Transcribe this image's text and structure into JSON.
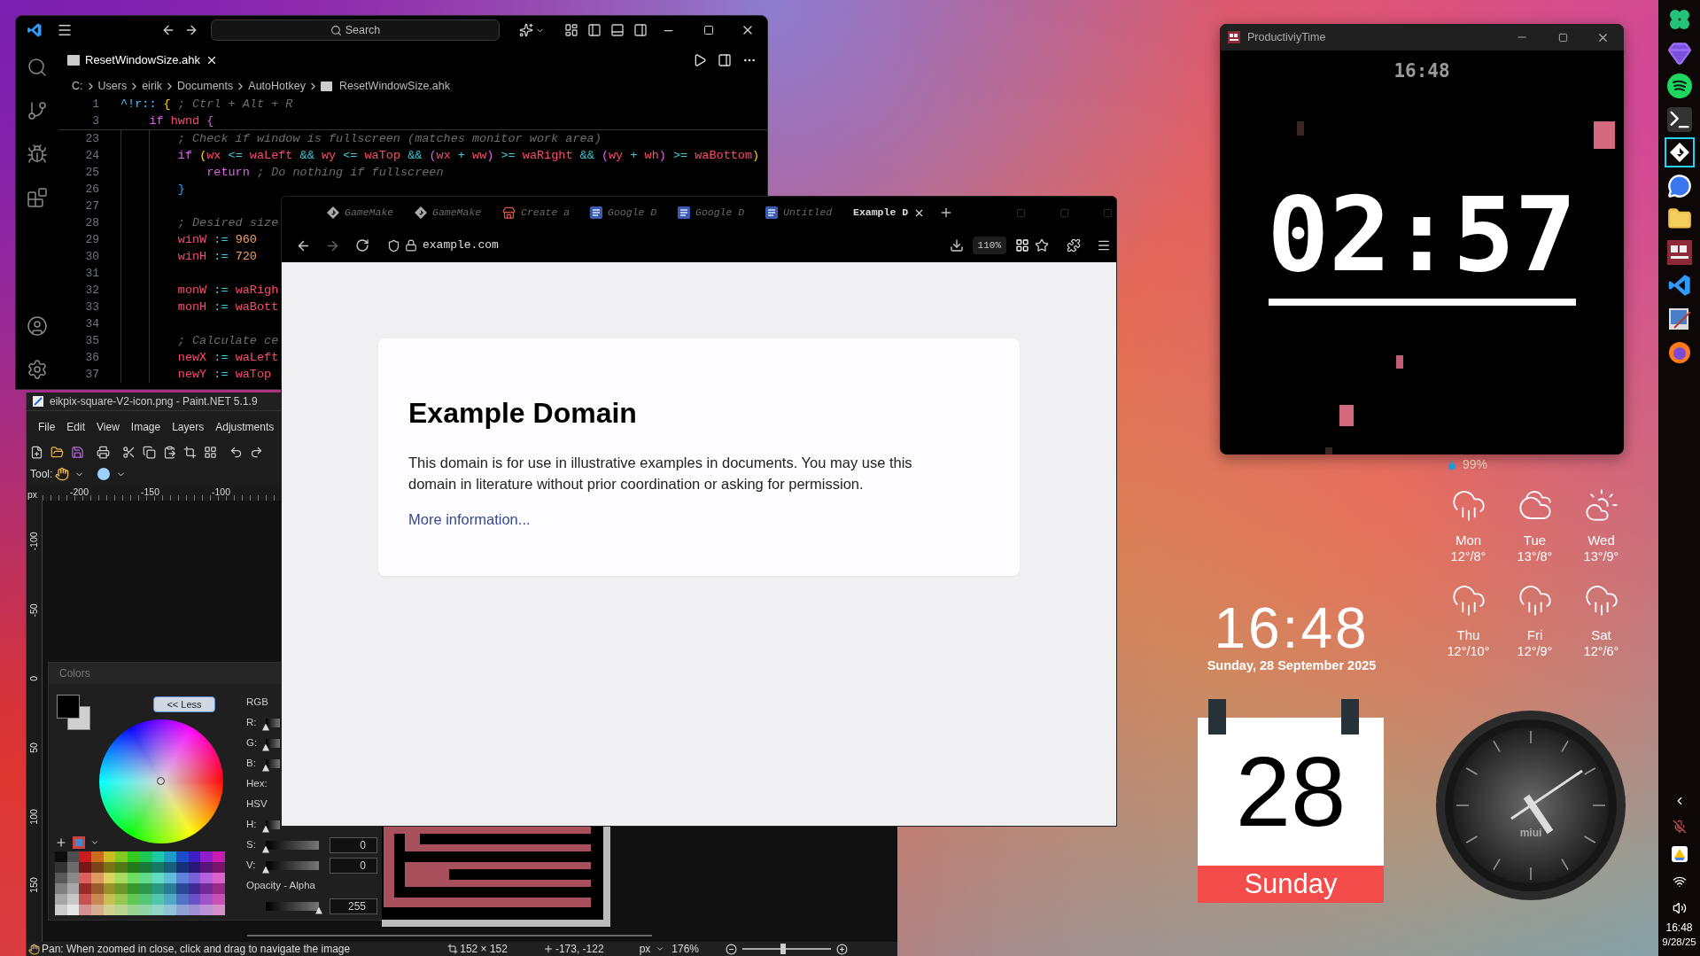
{
  "vscode": {
    "search": "Search",
    "tab": "ResetWindowSize.ahk",
    "breadcrumbs": [
      "C:",
      "Users",
      "eirik",
      "Documents",
      "AutoHotkey",
      "ResetWindowSize.ahk"
    ],
    "sticky_lines": [
      {
        "number": "1",
        "tokens": [
          {
            "text": "^!r:: ",
            "kind": "label"
          },
          {
            "text": "{ ",
            "kind": "bracket"
          },
          {
            "text": "; Ctrl + Alt + R",
            "kind": "comment"
          }
        ]
      },
      {
        "number": "3",
        "tokens": [
          {
            "text": "    if ",
            "kind": "keyword"
          },
          {
            "text": "hwnd ",
            "kind": "variable"
          },
          {
            "text": "{",
            "kind": "bracket2"
          }
        ]
      }
    ],
    "lines": [
      {
        "number": "23",
        "tokens": [
          {
            "text": "        ; Check if window is fullscreen (matches monitor work area)",
            "kind": "comment"
          }
        ]
      },
      {
        "number": "24",
        "tokens": [
          {
            "text": "        if ",
            "kind": "keyword"
          },
          {
            "text": "(",
            "kind": "bracket"
          },
          {
            "text": "wx ",
            "kind": "variable"
          },
          {
            "text": "<= ",
            "kind": "operator"
          },
          {
            "text": "waLeft ",
            "kind": "variable"
          },
          {
            "text": "&& ",
            "kind": "operator"
          },
          {
            "text": "wy ",
            "kind": "variable"
          },
          {
            "text": "<= ",
            "kind": "operator"
          },
          {
            "text": "waTop ",
            "kind": "variable"
          },
          {
            "text": "&& ",
            "kind": "operator"
          },
          {
            "text": "(",
            "kind": "bracket2"
          },
          {
            "text": "wx ",
            "kind": "variable"
          },
          {
            "text": "+ ",
            "kind": "operator"
          },
          {
            "text": "ww",
            "kind": "variable"
          },
          {
            "text": ") ",
            "kind": "bracket2"
          },
          {
            "text": ">= ",
            "kind": "operator"
          },
          {
            "text": "waRight ",
            "kind": "variable"
          },
          {
            "text": "&& ",
            "kind": "operator"
          },
          {
            "text": "(",
            "kind": "bracket2"
          },
          {
            "text": "wy ",
            "kind": "variable"
          },
          {
            "text": "+ ",
            "kind": "operator"
          },
          {
            "text": "wh",
            "kind": "variable"
          },
          {
            "text": ") ",
            "kind": "bracket2"
          },
          {
            "text": ">= ",
            "kind": "operator"
          },
          {
            "text": "waBottom",
            "kind": "variable"
          },
          {
            "text": ")",
            "kind": "bracket"
          }
        ]
      },
      {
        "number": "25",
        "tokens": [
          {
            "text": "            return ",
            "kind": "keyword"
          },
          {
            "text": "; Do nothing if fullscreen",
            "kind": "comment"
          }
        ]
      },
      {
        "number": "26",
        "tokens": [
          {
            "text": "        }",
            "kind": "bracket3"
          }
        ]
      },
      {
        "number": "27"
      },
      {
        "number": "28",
        "tokens": [
          {
            "text": "        ; Desired size",
            "kind": "comment"
          }
        ]
      },
      {
        "number": "29",
        "tokens": [
          {
            "text": "        winW ",
            "kind": "variable"
          },
          {
            "text": ":= ",
            "kind": "operator"
          },
          {
            "text": "960",
            "kind": "number"
          }
        ]
      },
      {
        "number": "30",
        "tokens": [
          {
            "text": "        winH ",
            "kind": "variable"
          },
          {
            "text": ":= ",
            "kind": "operator"
          },
          {
            "text": "720",
            "kind": "number"
          }
        ]
      },
      {
        "number": "31"
      },
      {
        "number": "32",
        "tokens": [
          {
            "text": "        monW ",
            "kind": "variable"
          },
          {
            "text": ":= ",
            "kind": "operator"
          },
          {
            "text": "waRigh",
            "kind": "variable"
          }
        ]
      },
      {
        "number": "33",
        "tokens": [
          {
            "text": "        monH ",
            "kind": "variable"
          },
          {
            "text": ":= ",
            "kind": "operator"
          },
          {
            "text": "waBott",
            "kind": "variable"
          }
        ]
      },
      {
        "number": "34"
      },
      {
        "number": "35",
        "tokens": [
          {
            "text": "        ; Calculate ce",
            "kind": "comment"
          }
        ]
      },
      {
        "number": "36",
        "tokens": [
          {
            "text": "        newX ",
            "kind": "variable"
          },
          {
            "text": ":= ",
            "kind": "operator"
          },
          {
            "text": "waLeft",
            "kind": "variable"
          }
        ]
      },
      {
        "number": "37",
        "tokens": [
          {
            "text": "        newY ",
            "kind": "variable"
          },
          {
            "text": ":= ",
            "kind": "operator"
          },
          {
            "text": "waTop",
            "kind": "variable"
          }
        ]
      }
    ]
  },
  "paint": {
    "title": "eikpix-square-V2-icon.png - Paint.NET 5.1.9",
    "menu": [
      "File",
      "Edit",
      "View",
      "Image",
      "Layers",
      "Adjustments"
    ],
    "tool_label": "Tool:",
    "ruler_unit": "px",
    "ruler_h": [
      "-200",
      "-150",
      "-100"
    ],
    "ruler_v": [
      "-100",
      "-50",
      "0",
      "50",
      "100",
      "150"
    ],
    "colors": {
      "title": "Colors",
      "less_button": "<< Less",
      "rows": [
        {
          "label": "RGB",
          "kind": "heading"
        },
        {
          "label": "R:",
          "kind": "slider",
          "level": 0
        },
        {
          "label": "G:",
          "kind": "slider",
          "level": 0
        },
        {
          "label": "B:",
          "kind": "slider",
          "level": 0
        },
        {
          "label": "Hex:",
          "kind": "heading"
        },
        {
          "label": "HSV",
          "kind": "heading"
        },
        {
          "label": "H:",
          "kind": "slider",
          "level": 0
        },
        {
          "label": "S:",
          "kind": "slider",
          "value": "0",
          "level": 0
        },
        {
          "label": "V:",
          "kind": "slider",
          "value": "0",
          "level": 0
        },
        {
          "label": "Opacity - Alpha",
          "kind": "heading"
        },
        {
          "kind": "slider",
          "value": "255",
          "level": 1
        }
      ]
    },
    "status": {
      "hint": "Pan: When zoomed in close, click and drag to navigate the image",
      "size": "152 × 152",
      "position": "-173, -122",
      "unit": "px",
      "zoom": "176%",
      "zoom_slider": {
        "level": 0.46
      }
    }
  },
  "browser": {
    "tabs": [
      {
        "label": "GameMake",
        "kind": "diamond",
        "selected": false
      },
      {
        "label": "GameMake",
        "kind": "diamond",
        "selected": false
      },
      {
        "label": "Create a",
        "kind": "shop",
        "selected": false
      },
      {
        "label": "Google D",
        "kind": "document",
        "selected": false
      },
      {
        "label": "Google D",
        "kind": "document",
        "selected": false
      },
      {
        "label": "Untitled",
        "kind": "document",
        "selected": false
      },
      {
        "label": "Example D",
        "kind": "plain",
        "selected": true
      }
    ],
    "url": "example.com",
    "zoom": "110%",
    "page": {
      "heading": "Example Domain",
      "text": "This domain is for use in illustrative examples in documents. You may use this domain in literature without prior coordination or asking for permission.",
      "link": "More information..."
    }
  },
  "timer_app": {
    "title": "ProductiviyTime",
    "clock": "16:48",
    "timer": "02:57"
  },
  "widgets": {
    "humidity": "99%",
    "forecast": [
      {
        "day": "Mon",
        "temps": "12°/8°",
        "kind": "rain"
      },
      {
        "day": "Tue",
        "temps": "13°/8°",
        "kind": "cloudy"
      },
      {
        "day": "Wed",
        "temps": "13°/9°",
        "kind": "partly"
      },
      {
        "day": "Thu",
        "temps": "12°/10°",
        "kind": "rain"
      },
      {
        "day": "Fri",
        "temps": "12°/9°",
        "kind": "rain"
      },
      {
        "day": "Sat",
        "temps": "12°/6°",
        "kind": "rain"
      }
    ],
    "clock": {
      "time": "16:48",
      "date": "Sunday, 28 September 2025"
    },
    "calendar": {
      "day": "28",
      "weekday": "Sunday"
    },
    "analog_clock": {
      "brand": "miui"
    }
  },
  "taskbar": {
    "apps": [
      {
        "selected": false
      },
      {
        "selected": false
      },
      {
        "selected": false
      },
      {
        "selected": false
      },
      {
        "selected": true
      },
      {
        "selected": false
      },
      {
        "selected": false
      },
      {
        "selected": false
      },
      {
        "selected": false
      },
      {
        "selected": false
      },
      {
        "selected": false
      }
    ],
    "time": "16:48",
    "date": "9/28/25"
  }
}
